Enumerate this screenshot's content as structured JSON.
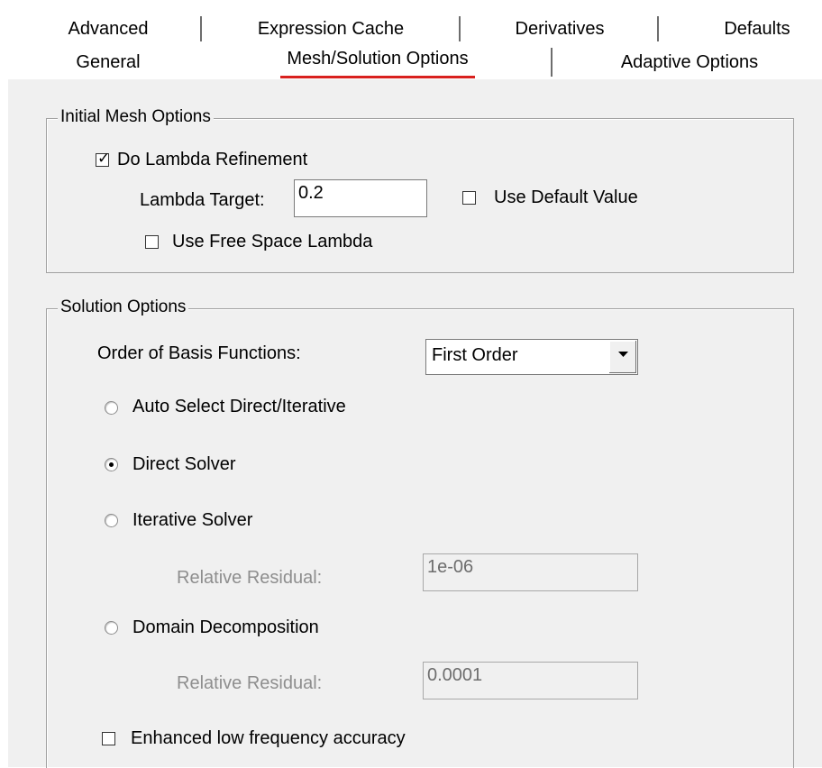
{
  "tabs_row1": [
    {
      "label": "Advanced"
    },
    {
      "label": "Expression Cache"
    },
    {
      "label": "Derivatives"
    },
    {
      "label": "Defaults"
    }
  ],
  "tabs_row2": [
    {
      "label": "General"
    },
    {
      "label": "Mesh/Solution Options"
    },
    {
      "label": "Adaptive Options"
    }
  ],
  "active_tab": "Mesh/Solution Options",
  "initial_mesh": {
    "legend": "Initial Mesh Options",
    "do_lambda_refinement": {
      "label": "Do Lambda Refinement",
      "checked": true
    },
    "lambda_target": {
      "label": "Lambda Target:",
      "value": "0.2"
    },
    "use_default_value": {
      "label": "Use Default Value",
      "checked": false
    },
    "use_free_space_lambda": {
      "label": "Use Free Space Lambda",
      "checked": false
    }
  },
  "solution_options": {
    "legend": "Solution Options",
    "order_of_basis": {
      "label": "Order of Basis Functions:",
      "value": "First Order"
    },
    "auto_select": {
      "label": "Auto Select Direct/Iterative",
      "selected": false
    },
    "direct_solver": {
      "label": "Direct Solver",
      "selected": true
    },
    "iterative_solver": {
      "label": "Iterative Solver",
      "selected": false
    },
    "iterative_residual": {
      "label": "Relative Residual:",
      "value": "1e-06"
    },
    "domain_decomposition": {
      "label": "Domain Decomposition",
      "selected": false
    },
    "domain_residual": {
      "label": "Relative Residual:",
      "value": "0.0001"
    },
    "enhanced_low_frequency": {
      "label": "Enhanced low frequency accuracy",
      "checked": false
    }
  },
  "colors": {
    "panel_bg": "#f0f0f0",
    "active_tab_accent": "#d9211e",
    "disabled_text": "#8e8e8e"
  }
}
